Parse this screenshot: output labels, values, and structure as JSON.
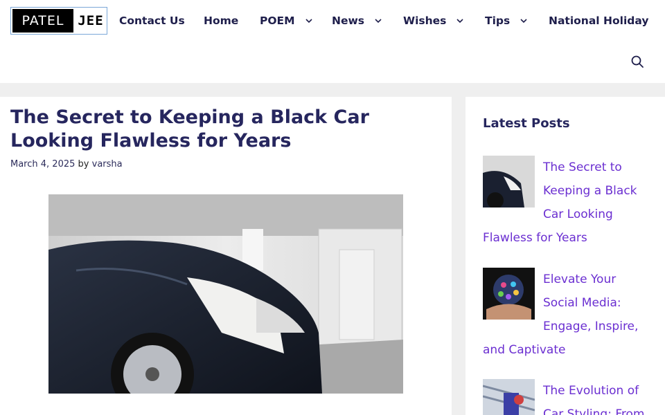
{
  "header": {
    "logo": {
      "left_text": "PATEL",
      "right_text": "JEE"
    },
    "nav": [
      {
        "label": "Contact Us",
        "has_dropdown": false
      },
      {
        "label": "Home",
        "has_dropdown": false
      },
      {
        "label": "POEM",
        "has_dropdown": true
      },
      {
        "label": "News",
        "has_dropdown": true
      },
      {
        "label": "Wishes",
        "has_dropdown": true
      },
      {
        "label": "Tips",
        "has_dropdown": true
      },
      {
        "label": "National Holiday",
        "has_dropdown": false
      }
    ],
    "search_icon": "search-icon"
  },
  "article": {
    "title": "The Secret to Keeping a Black Car Looking Flawless for Years",
    "date": "March 4, 2025",
    "by": "by",
    "author": "varsha"
  },
  "sidebar": {
    "title": "Latest Posts",
    "posts": [
      {
        "title": "The Secret to Keeping a Black Car Looking Flawless for Years"
      },
      {
        "title": "Elevate Your Social Media: Engage, Inspire, and Captivate"
      },
      {
        "title": "The Evolution of Car Styling: From"
      }
    ]
  },
  "colors": {
    "heading": "#26265e",
    "nav_text": "#1e1e4b",
    "link": "#6b2fd1",
    "page_bg": "#efefef"
  }
}
